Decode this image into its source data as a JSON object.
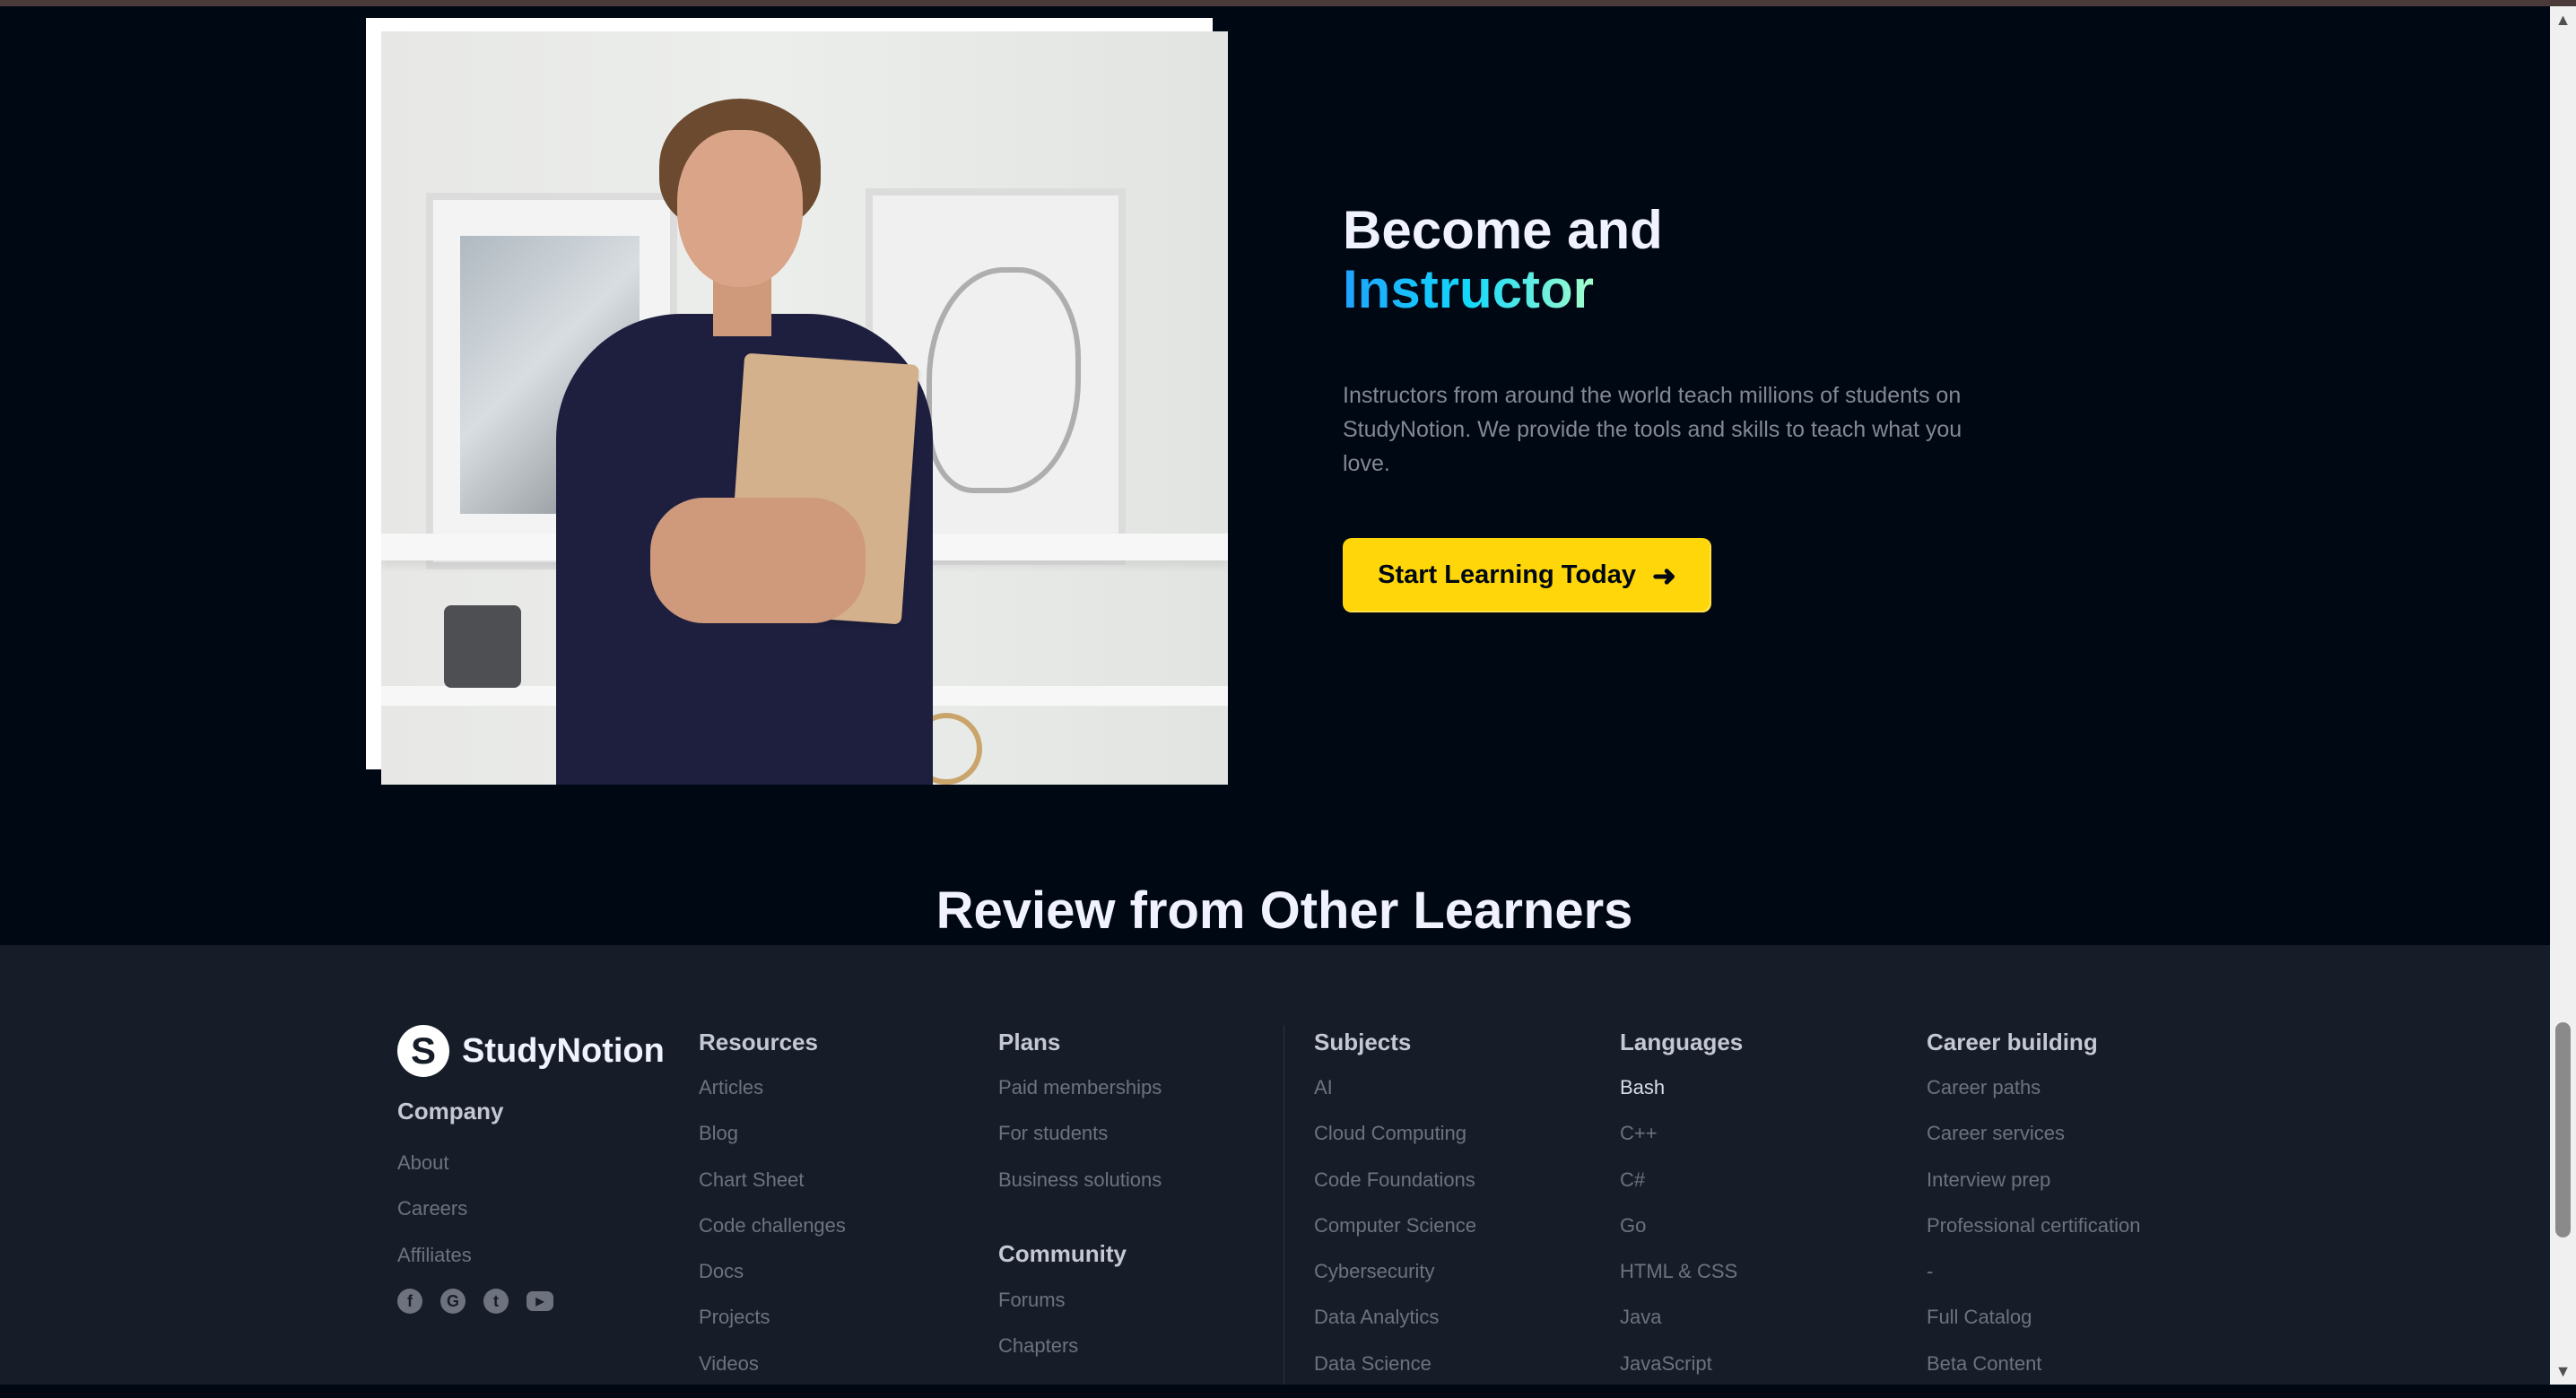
{
  "instructor": {
    "heading_line1": "Become and",
    "heading_highlight": "Instructor",
    "description": "Instructors from around the world teach millions of students on StudyNotion. We provide the tools and skills to teach what you love.",
    "cta_label": "Start Learning Today",
    "cta_icon": "arrow-right-icon"
  },
  "reviews": {
    "title": "Review from Other Learners"
  },
  "footer": {
    "brand": {
      "logo_letter": "S",
      "name": "StudyNotion"
    },
    "company": {
      "title": "Company",
      "links": [
        "About",
        "Careers",
        "Affiliates"
      ]
    },
    "socials": [
      "facebook-icon",
      "google-icon",
      "twitter-icon",
      "youtube-icon"
    ],
    "resources": {
      "title": "Resources",
      "links": [
        "Articles",
        "Blog",
        "Chart Sheet",
        "Code challenges",
        "Docs",
        "Projects",
        "Videos"
      ]
    },
    "plans": {
      "title": "Plans",
      "links": [
        "Paid memberships",
        "For students",
        "Business solutions"
      ]
    },
    "community": {
      "title": "Community",
      "links": [
        "Forums",
        "Chapters"
      ]
    },
    "subjects": {
      "title": "Subjects",
      "links": [
        "AI",
        "Cloud Computing",
        "Code Foundations",
        "Computer Science",
        "Cybersecurity",
        "Data Analytics",
        "Data Science"
      ]
    },
    "languages": {
      "title": "Languages",
      "links": [
        "Bash",
        "C++",
        "C#",
        "Go",
        "HTML & CSS",
        "Java",
        "JavaScript"
      ]
    },
    "career": {
      "title": "Career building",
      "links": [
        "Career paths",
        "Career services",
        "Interview prep",
        "Professional certification",
        "-",
        "Full Catalog",
        "Beta Content"
      ]
    }
  },
  "colors": {
    "background": "#000814",
    "footer": "#161d29",
    "accent_yellow": "#ffd60a",
    "heading": "#f1f2ff",
    "muted": "#838894"
  }
}
